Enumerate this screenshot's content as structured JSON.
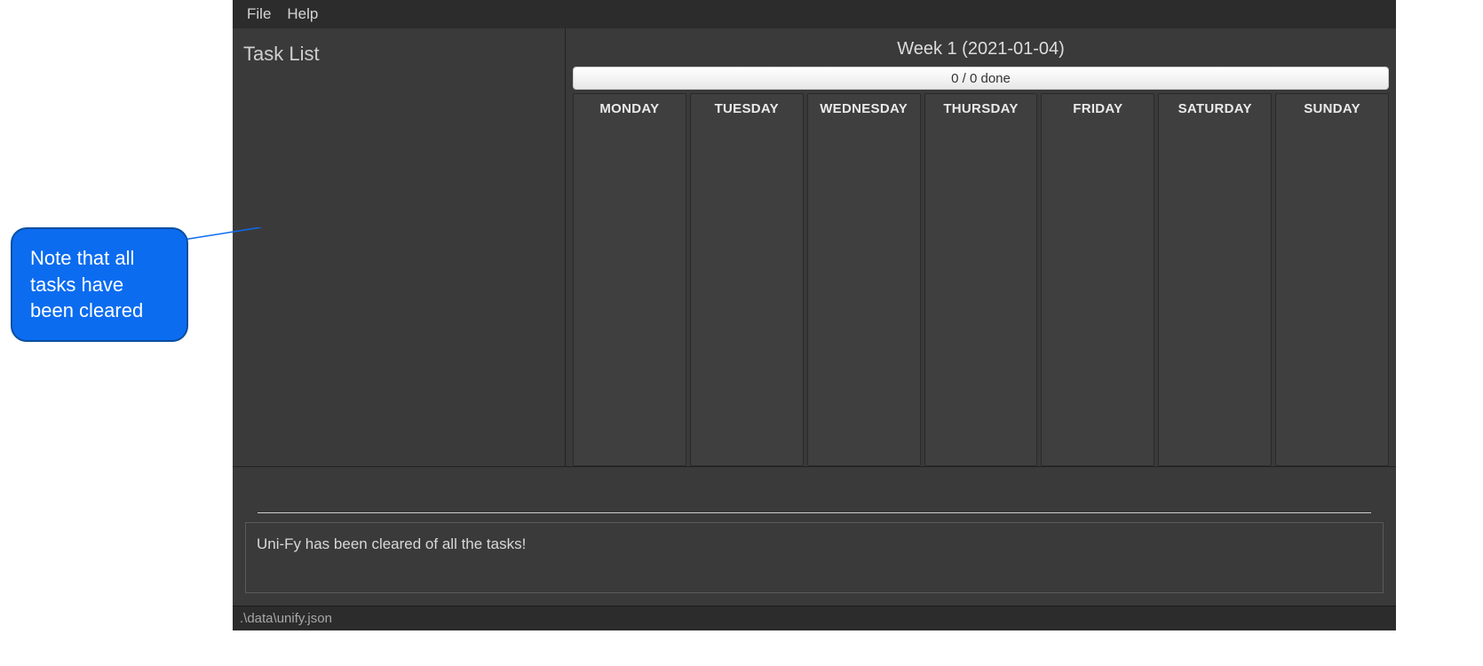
{
  "menubar": {
    "file": "File",
    "help": "Help"
  },
  "sidebar": {
    "title": "Task List"
  },
  "week": {
    "header": "Week 1 (2021-01-04)",
    "progress": "0 / 0 done",
    "days": {
      "mon": "MONDAY",
      "tue": "TUESDAY",
      "wed": "WEDNESDAY",
      "thu": "THURSDAY",
      "fri": "FRIDAY",
      "sat": "SATURDAY",
      "sun": "SUNDAY"
    }
  },
  "message": "Uni-Fy has been cleared of all the tasks!",
  "status_path": ".\\data\\unify.json",
  "callout": "Note that all tasks have been cleared"
}
